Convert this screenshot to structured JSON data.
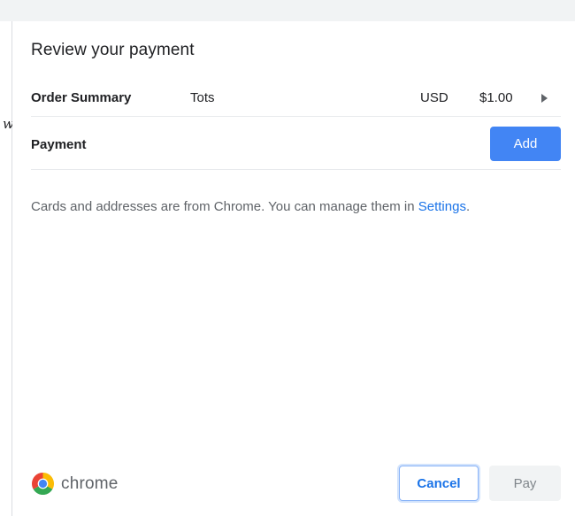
{
  "background": {
    "fragment_text": "w"
  },
  "dialog": {
    "title": "Review your payment",
    "order_summary": {
      "label": "Order Summary",
      "item": "Tots",
      "currency": "USD",
      "amount": "$1.00",
      "expand_icon": "triangle-right-icon"
    },
    "payment": {
      "label": "Payment",
      "add_label": "Add"
    },
    "info": {
      "text": "Cards and addresses are from Chrome. You can manage them in ",
      "link": "Settings",
      "suffix": "."
    },
    "footer": {
      "brand_icon": "chrome-logo-icon",
      "brand": "chrome",
      "cancel_label": "Cancel",
      "pay_label": "Pay"
    }
  },
  "colors": {
    "accent": "#4285f4",
    "link": "#1a73e8",
    "disabled_bg": "#f1f3f4",
    "disabled_text": "#80868b"
  }
}
